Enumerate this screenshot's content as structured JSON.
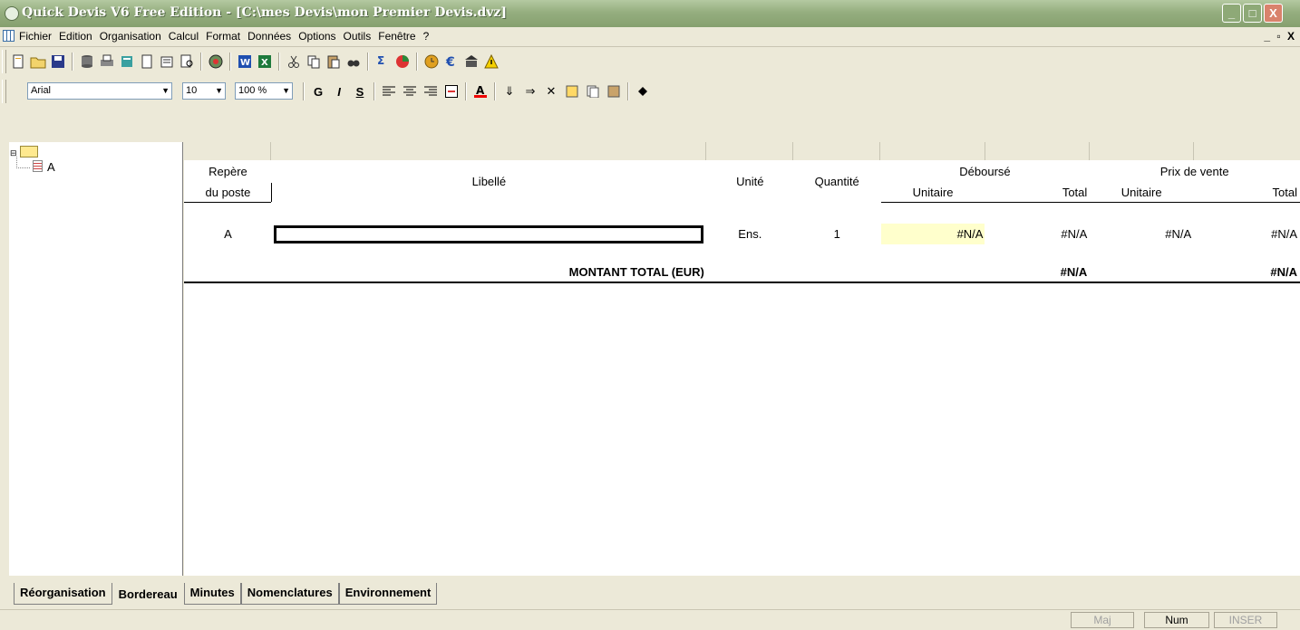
{
  "window": {
    "title": "Quick Devis V6 Free Edition - [C:\\mes Devis\\mon Premier Devis.dvz]",
    "minimize": "_",
    "maximize": "□",
    "close": "X"
  },
  "menu": {
    "items": [
      "Fichier",
      "Edition",
      "Organisation",
      "Calcul",
      "Format",
      "Données",
      "Options",
      "Outils",
      "Fenêtre",
      "?"
    ],
    "mdi_controls": "_ ▫ X"
  },
  "format_toolbar": {
    "font": "Arial",
    "size": "10",
    "zoom": "100 %",
    "bold": "G",
    "italic": "I",
    "underline": "S"
  },
  "tree": {
    "node_label": "A"
  },
  "sheet": {
    "headers": {
      "repere_line1": "Repère",
      "repere_line2": "du poste",
      "libelle": "Libellé",
      "unite": "Unité",
      "quantite": "Quantité",
      "debourse": "Déboursé",
      "prix_vente": "Prix de vente",
      "unitaire": "Unitaire",
      "total": "Total"
    },
    "row": {
      "repere": "A",
      "libelle": "",
      "unite": "Ens.",
      "quantite": "1",
      "deb_unitaire": "#N/A",
      "deb_total": "#N/A",
      "pv_unitaire": "#N/A",
      "pv_total": "#N/A"
    },
    "total_row": {
      "label": "MONTANT TOTAL (EUR)",
      "deb_total": "#N/A",
      "pv_total": "#N/A"
    }
  },
  "tabs": [
    "Réorganisation",
    "Bordereau",
    "Minutes",
    "Nomenclatures",
    "Environnement"
  ],
  "active_tab": "Bordereau",
  "status": {
    "maj": "Maj",
    "num": "Num",
    "inser": "INSER"
  },
  "colors": {
    "titlebar": "#95ae7f",
    "chrome": "#ece9d8",
    "highlight_cell": "#ffffcc"
  }
}
